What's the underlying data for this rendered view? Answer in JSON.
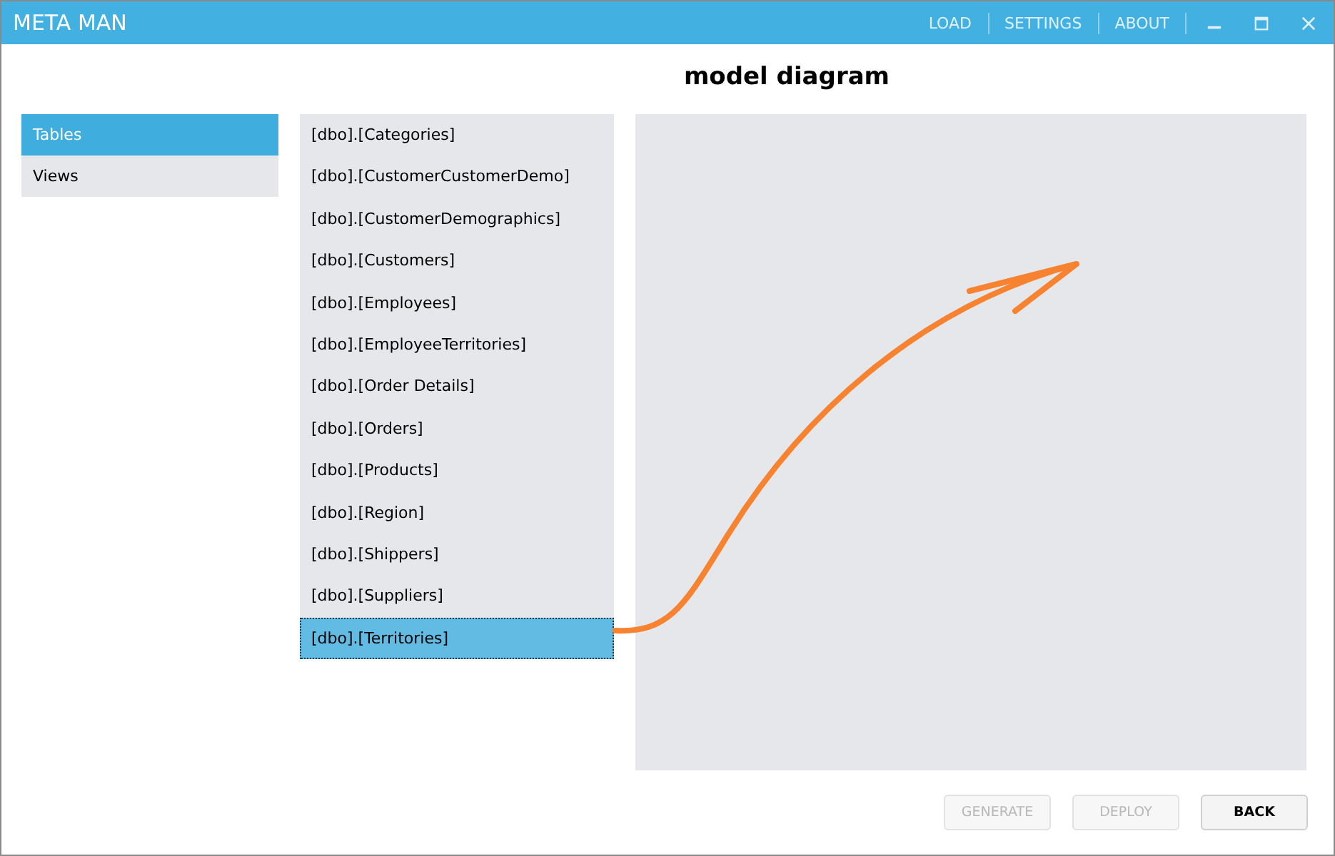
{
  "window": {
    "title": "META MAN",
    "menu": [
      "LOAD",
      "SETTINGS",
      "ABOUT"
    ]
  },
  "heading": "model diagram",
  "sidebar": {
    "items": [
      {
        "label": "Tables",
        "selected": true
      },
      {
        "label": "Views",
        "selected": false
      }
    ]
  },
  "tables": [
    {
      "label": "[dbo].[Categories]",
      "selected": false
    },
    {
      "label": "[dbo].[CustomerCustomerDemo]",
      "selected": false
    },
    {
      "label": "[dbo].[CustomerDemographics]",
      "selected": false
    },
    {
      "label": "[dbo].[Customers]",
      "selected": false
    },
    {
      "label": "[dbo].[Employees]",
      "selected": false
    },
    {
      "label": "[dbo].[EmployeeTerritories]",
      "selected": false
    },
    {
      "label": "[dbo].[Order Details]",
      "selected": false
    },
    {
      "label": "[dbo].[Orders]",
      "selected": false
    },
    {
      "label": "[dbo].[Products]",
      "selected": false
    },
    {
      "label": "[dbo].[Region]",
      "selected": false
    },
    {
      "label": "[dbo].[Shippers]",
      "selected": false
    },
    {
      "label": "[dbo].[Suppliers]",
      "selected": false
    },
    {
      "label": "[dbo].[Territories]",
      "selected": true
    }
  ],
  "buttons": [
    {
      "label": "GENERATE",
      "disabled": true
    },
    {
      "label": "DEPLOY",
      "disabled": true
    },
    {
      "label": "BACK",
      "disabled": false
    }
  ]
}
